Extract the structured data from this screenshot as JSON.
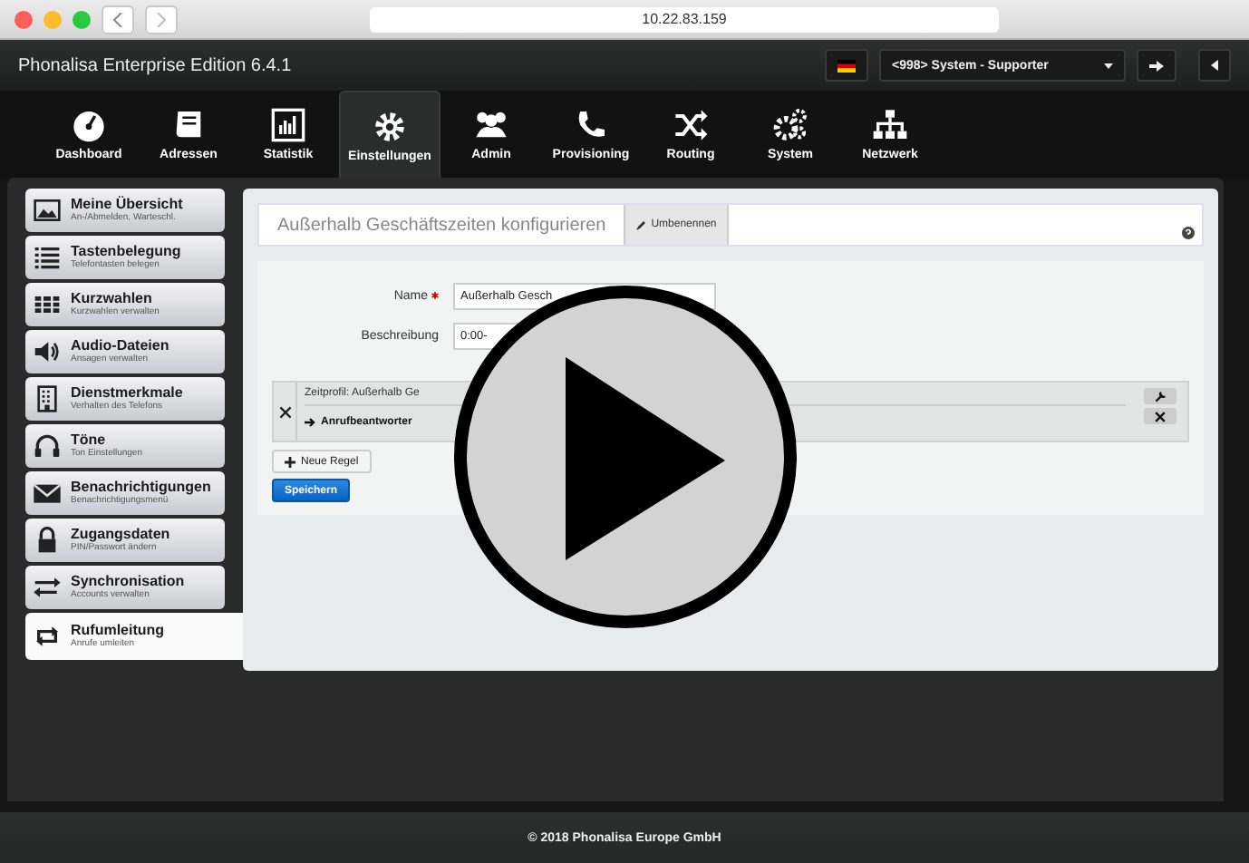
{
  "browser": {
    "url": "10.22.83.159"
  },
  "header": {
    "title": "Phonalisa Enterprise Edition 6.4.1",
    "user_select": "<998> System - Supporter"
  },
  "nav": [
    {
      "label": "Dashboard",
      "kind": "gauge",
      "selected": false
    },
    {
      "label": "Adressen",
      "kind": "book",
      "selected": false
    },
    {
      "label": "Statistik",
      "kind": "chart",
      "selected": false
    },
    {
      "label": "Einstellungen",
      "kind": "gear",
      "selected": true
    },
    {
      "label": "Admin",
      "kind": "users",
      "selected": false
    },
    {
      "label": "Provisioning",
      "kind": "phone",
      "selected": false
    },
    {
      "label": "Routing",
      "kind": "shuffle",
      "selected": false
    },
    {
      "label": "System",
      "kind": "gears",
      "selected": false
    },
    {
      "label": "Netzwerk",
      "kind": "network",
      "selected": false
    }
  ],
  "sidebar": [
    {
      "title": "Meine Übersicht",
      "subtitle": "An-/Abmelden, Warteschl.",
      "kind": "picture",
      "selected": false
    },
    {
      "title": "Tastenbelegung",
      "subtitle": "Telefontasten belegen",
      "kind": "list",
      "selected": false
    },
    {
      "title": "Kurzwahlen",
      "subtitle": "Kurzwahlen verwalten",
      "kind": "grid",
      "selected": false
    },
    {
      "title": "Audio-Dateien",
      "subtitle": "Ansagen verwalten",
      "kind": "speaker",
      "selected": false
    },
    {
      "title": "Dienstmerkmale",
      "subtitle": "Verhalten des Telefons",
      "kind": "building",
      "selected": false
    },
    {
      "title": "Töne",
      "subtitle": "Ton Einstellungen",
      "kind": "headphones",
      "selected": false
    },
    {
      "title": "Benachrichtigungen",
      "subtitle": "Benachrichtigungsmenü",
      "kind": "mail",
      "selected": false
    },
    {
      "title": "Zugangsdaten",
      "subtitle": "PIN/Passwort ändern",
      "kind": "lock",
      "selected": false
    },
    {
      "title": "Synchronisation",
      "subtitle": "Accounts verwalten",
      "kind": "sync",
      "selected": false
    },
    {
      "title": "Rufumleitung",
      "subtitle": "Anrufe umleiten",
      "kind": "redirect",
      "selected": true
    }
  ],
  "page": {
    "title": "Außerhalb Geschäftszeiten konfigurieren",
    "rename_button": "Umbenennen",
    "fields": [
      {
        "label": "Name",
        "required": true,
        "value": "Außerhalb Gesch"
      },
      {
        "label": "Beschreibung",
        "required": false,
        "value": "0:00-"
      }
    ],
    "rules": [
      {
        "profile": "Zeitprofil: Außerhalb Ge",
        "action": "Anrufbeantworter"
      }
    ],
    "add_rule_button": "Neue Regel",
    "save_button": "Speichern"
  },
  "footer": "© 2018 Phonalisa Europe GmbH"
}
